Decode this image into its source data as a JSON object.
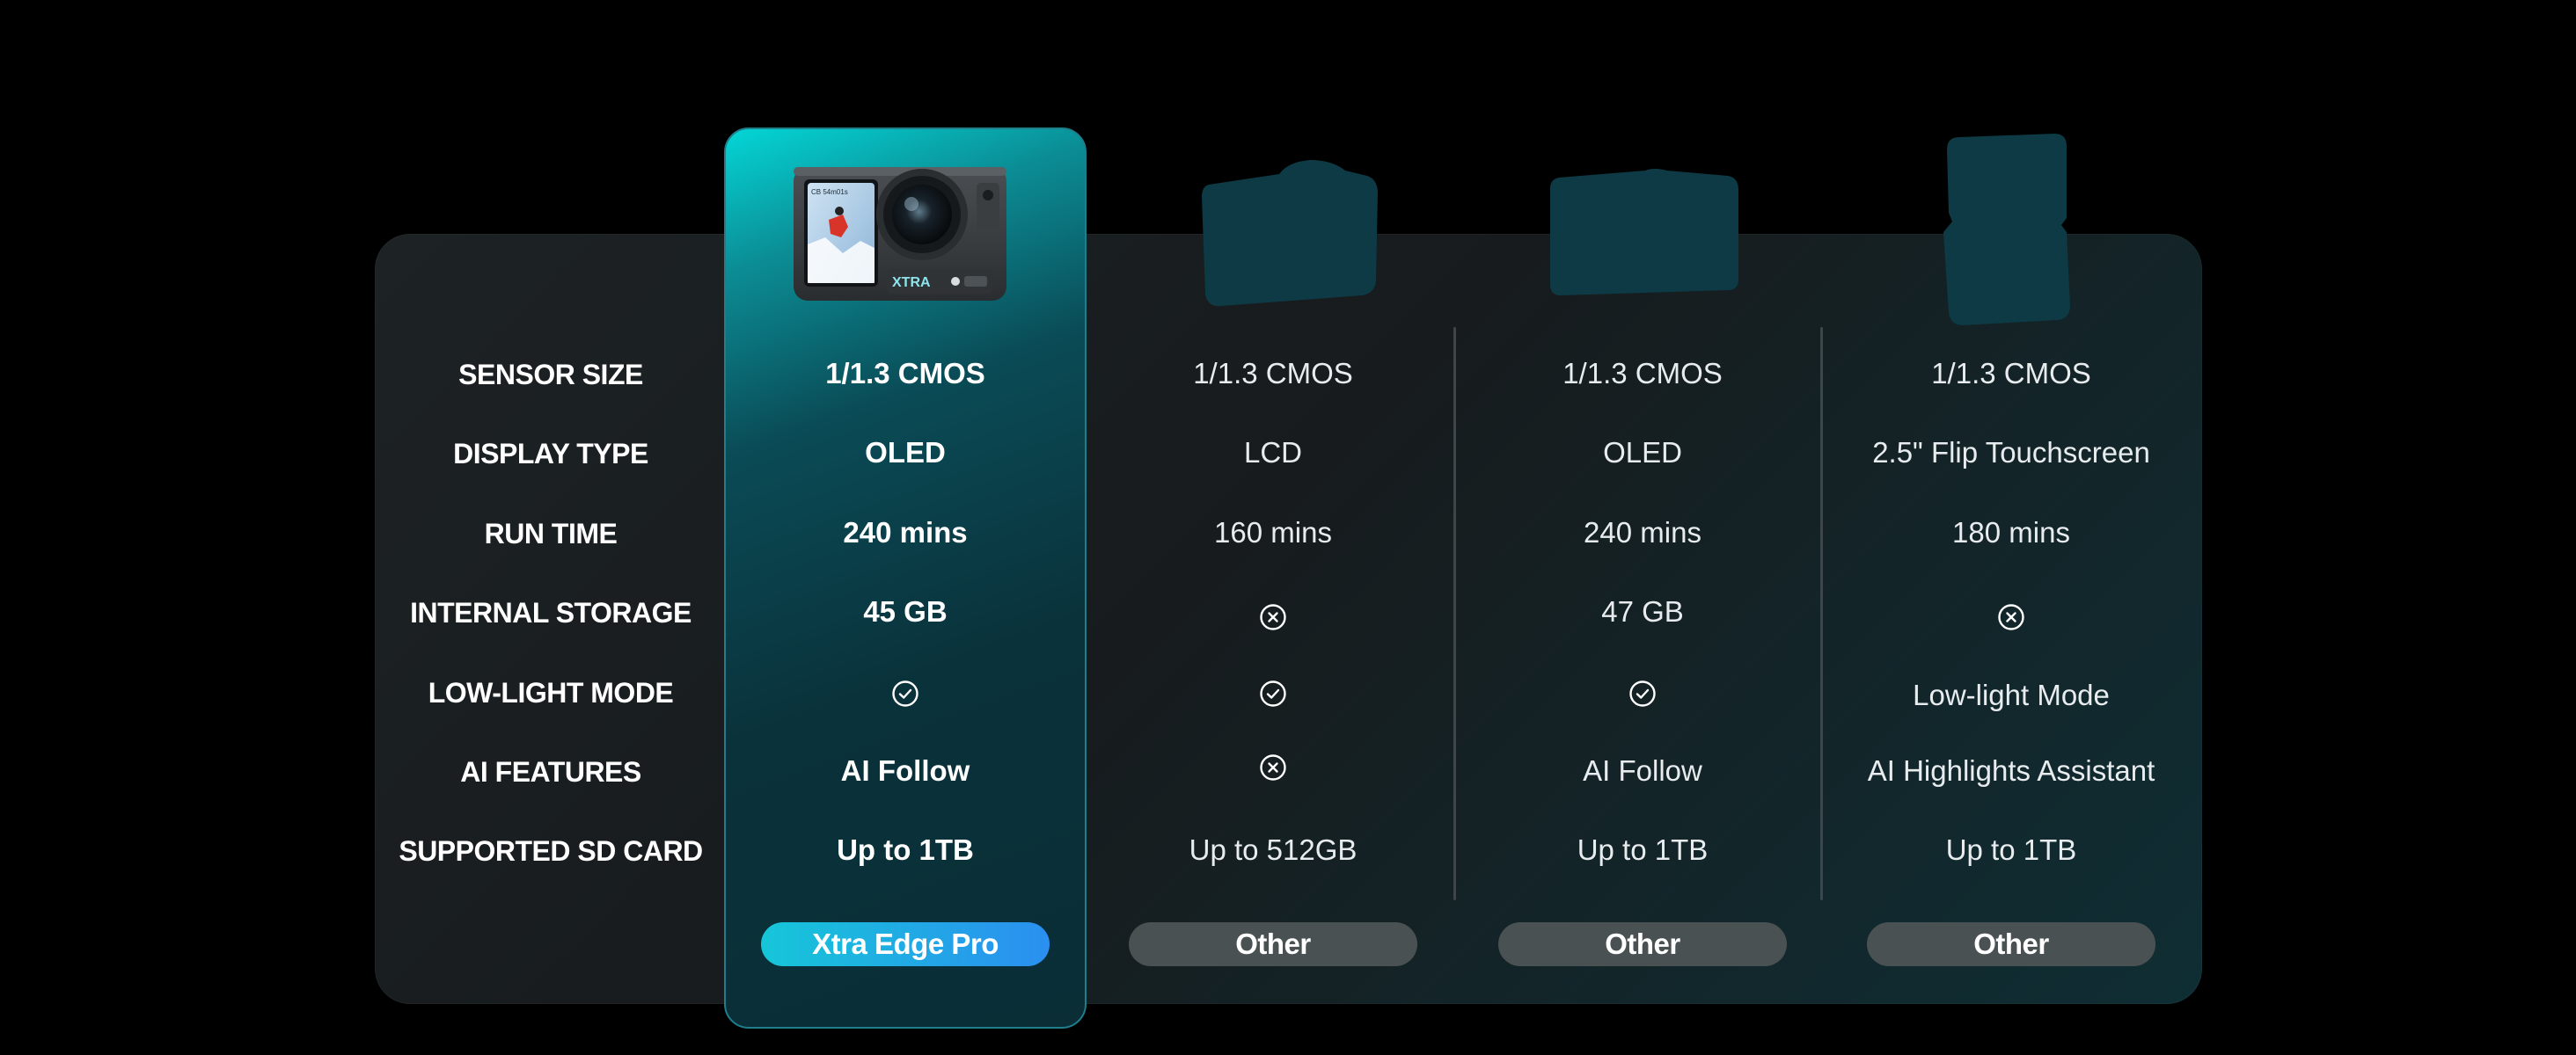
{
  "row_labels": [
    "SENSOR SIZE",
    "DISPLAY TYPE",
    "RUN TIME",
    "INTERNAL STORAGE",
    "LOW-LIGHT MODE",
    "AI FEATURES",
    "SUPPORTED SD CARD"
  ],
  "columns": [
    {
      "name": "Xtra Edge Pro",
      "sensor_size": "1/1.3 CMOS",
      "display_type": "OLED",
      "run_time": "240 mins",
      "internal_storage": "45 GB",
      "low_light_mode": "check-circle-icon",
      "ai_features": "AI Follow",
      "sd_card": "Up to 1TB"
    },
    {
      "name": "Other",
      "sensor_size": "1/1.3 CMOS",
      "display_type": "LCD",
      "run_time": "160 mins",
      "internal_storage": "x-circle-icon",
      "low_light_mode": "check-circle-icon",
      "ai_features": "x-circle-icon",
      "sd_card": "Up to 512GB"
    },
    {
      "name": "Other",
      "sensor_size": "1/1.3 CMOS",
      "display_type": "OLED",
      "run_time": "240 mins",
      "internal_storage": "47 GB",
      "low_light_mode": "check-circle-icon",
      "ai_features": "AI Follow",
      "sd_card": "Up to 1TB"
    },
    {
      "name": "Other",
      "sensor_size": "1/1.3 CMOS",
      "display_type": "2.5\" Flip Touchscreen",
      "run_time": "180 mins",
      "internal_storage": "x-circle-icon",
      "low_light_mode": "Low-light Mode",
      "ai_features": "AI Highlights Assistant",
      "sd_card": "Up to 1TB"
    }
  ],
  "camera_screen_text": "CB 54m01s",
  "camera_brand_text": "XTRA",
  "colors": {
    "background": "#000000",
    "panel": "#1b2022",
    "highlight_top": "#04d6d6",
    "highlight_bottom": "#0a2d36",
    "primary_pill_start": "#16c6d8",
    "primary_pill_end": "#2b8ff0",
    "secondary_pill": "#4a5153",
    "silhouette": "#0d3a44"
  }
}
